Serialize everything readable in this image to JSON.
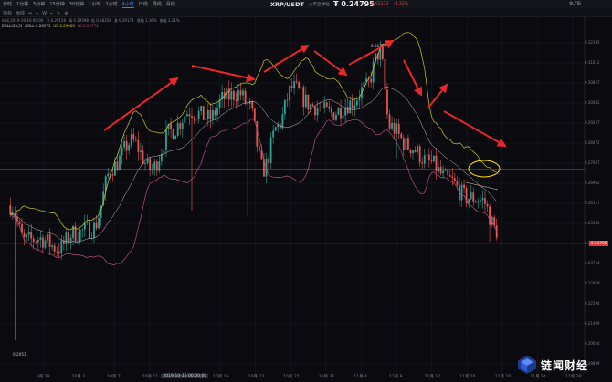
{
  "header": {
    "menu": [
      "分时",
      "1分钟",
      "5分钟",
      "15分钟",
      "30分钟",
      "1小时",
      "2小时",
      "4小时",
      "日线",
      "周线",
      "月线"
    ],
    "pair": "XRP/USDT",
    "exchange": "火币全球站",
    "price": "₮ 0.24795",
    "change": "-0.01133",
    "change_pct": "-4.33%",
    "controls": [
      "⚙",
      "⤢",
      "⊞"
    ]
  },
  "toolbar": {
    "items": [
      "指标",
      "画线",
      "↔",
      "⌖",
      "W",
      "⌁",
      "✎",
      "⊕"
    ]
  },
  "indicators": {
    "ohlc": [
      "时间 2019-10-16 00:00",
      "开 0.29156",
      "高 0.29598",
      "低 0.28358",
      "收 0.29178",
      "涨幅 1.36%",
      "振幅 3.21%"
    ],
    "boll": [
      "BOLL(20,2)",
      "BOLL 0.28571",
      "UB 0.29968",
      "LB 0.26774"
    ]
  },
  "colors": {
    "up": "#26a69a",
    "down": "#ef5350",
    "boll_mid": "#c8c8c8",
    "boll_upper": "#c9c43a",
    "boll_lower": "#b0507a",
    "arrow": "#e8262b",
    "ellipse": "#ffe400",
    "price_tag": "#e03a3a"
  },
  "y_axis": {
    "ticks": [
      "0.32395",
      "0.31612",
      "0.30827",
      "0.30042",
      "0.29257",
      "0.28472",
      "0.27687",
      "0.26902",
      "0.26117",
      "0.25334",
      "0.24549",
      "0.23764",
      "0.22979",
      "0.22194",
      "0.21409",
      "0.20624",
      "0.19839"
    ],
    "current_price": "0.24795",
    "ylim": [
      0.1962,
      0.3256
    ]
  },
  "x_axis": {
    "ticks": [
      "9月 29",
      "10月 3",
      "10月 7",
      "10月 11",
      "2019-10-16 00:00:00",
      "10月 19",
      "10月 23",
      "10月 27",
      "10月 31",
      "11月 4",
      "11月 8",
      "11月 12",
      "11月 16",
      "11月 20",
      "11月 24",
      "11月 28"
    ],
    "highlight_index": 4
  },
  "annotations": {
    "low_label": "0.2051",
    "high_label": "0.3175"
  },
  "watermark": {
    "text": "链闻财经"
  },
  "chart_data": {
    "type": "candlestick",
    "x_range": [
      "2019-09-27",
      "2019-11-19"
    ],
    "ylim": [
      0.1962,
      0.3256
    ],
    "grid": true,
    "overlays": [
      "BOLL upper",
      "BOLL middle",
      "BOLL lower"
    ],
    "anchors": [
      {
        "t": 0.0,
        "p": 0.258
      },
      {
        "t": 0.03,
        "p": 0.244
      },
      {
        "t": 0.06,
        "p": 0.245
      },
      {
        "t": 0.1,
        "p": 0.241
      },
      {
        "t": 0.13,
        "p": 0.247
      },
      {
        "t": 0.17,
        "p": 0.249
      },
      {
        "t": 0.21,
        "p": 0.273
      },
      {
        "t": 0.25,
        "p": 0.283
      },
      {
        "t": 0.29,
        "p": 0.272
      },
      {
        "t": 0.33,
        "p": 0.287
      },
      {
        "t": 0.37,
        "p": 0.295
      },
      {
        "t": 0.41,
        "p": 0.292
      },
      {
        "t": 0.44,
        "p": 0.3
      },
      {
        "t": 0.47,
        "p": 0.302
      },
      {
        "t": 0.49,
        "p": 0.297
      },
      {
        "t": 0.52,
        "p": 0.272
      },
      {
        "t": 0.55,
        "p": 0.289
      },
      {
        "t": 0.58,
        "p": 0.304
      },
      {
        "t": 0.62,
        "p": 0.297
      },
      {
        "t": 0.66,
        "p": 0.294
      },
      {
        "t": 0.7,
        "p": 0.298
      },
      {
        "t": 0.73,
        "p": 0.304
      },
      {
        "t": 0.76,
        "p": 0.318
      },
      {
        "t": 0.78,
        "p": 0.289
      },
      {
        "t": 0.82,
        "p": 0.281
      },
      {
        "t": 0.86,
        "p": 0.275
      },
      {
        "t": 0.9,
        "p": 0.268
      },
      {
        "t": 0.94,
        "p": 0.261
      },
      {
        "t": 0.97,
        "p": 0.26
      },
      {
        "t": 1.0,
        "p": 0.248
      }
    ]
  }
}
